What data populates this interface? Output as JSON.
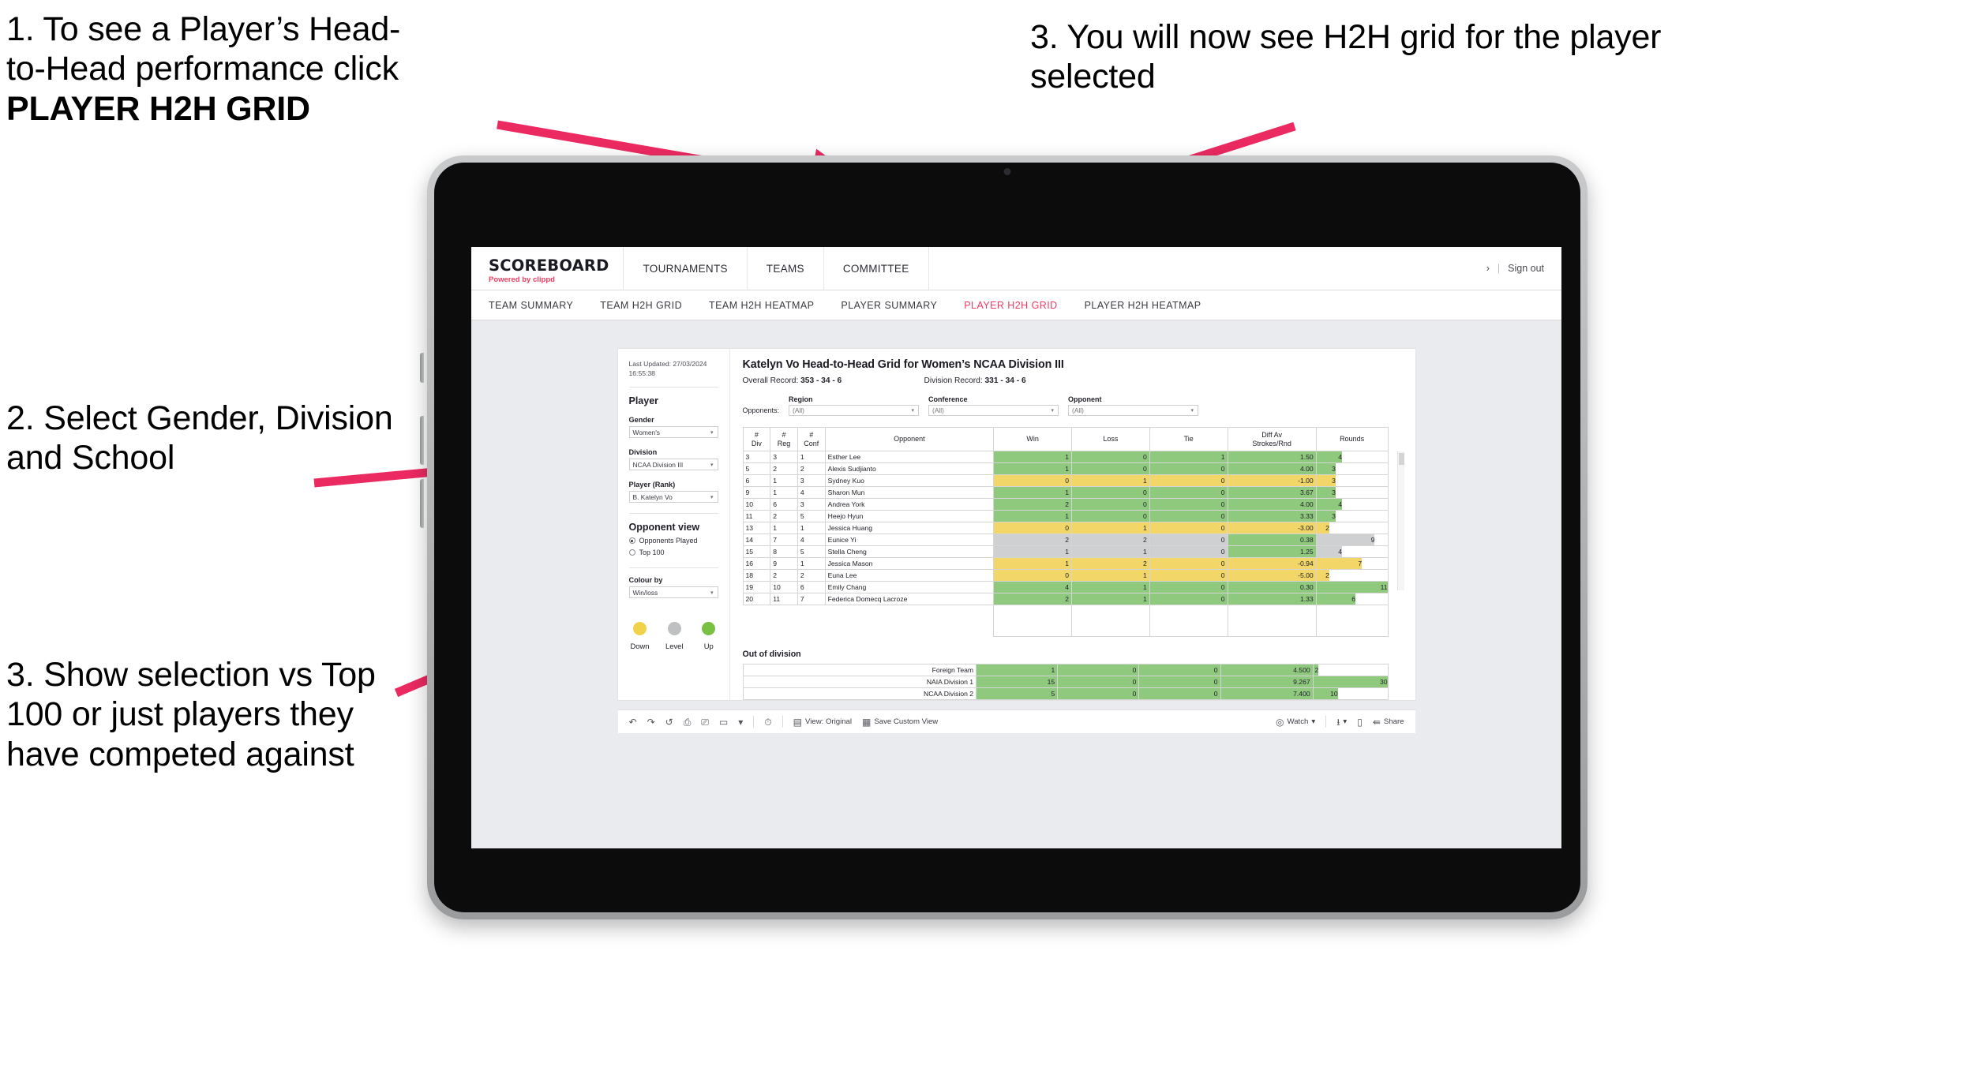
{
  "annotations": [
    {
      "id": "anno1",
      "line1": "1. To see a Player’s Head-",
      "line2": "to-Head performance click",
      "bold": "PLAYER H2H GRID"
    },
    {
      "id": "anno2",
      "text": "2. Select Gender, Division and School"
    },
    {
      "id": "anno3",
      "text": "3. Show selection vs Top 100 or just players they have competed against"
    },
    {
      "id": "anno4",
      "text": "3. You will now see H2H grid for the player selected"
    }
  ],
  "brand": {
    "logo": "SCOREBOARD",
    "powered_prefix": "Powered by ",
    "powered_name": "clippd"
  },
  "topnav": {
    "items": [
      "TOURNAMENTS",
      "TEAMS",
      "COMMITTEE"
    ],
    "chevron": "›",
    "separator": "|",
    "signout": "Sign out"
  },
  "tabs": [
    {
      "label": "TEAM SUMMARY",
      "active": false
    },
    {
      "label": "TEAM H2H GRID",
      "active": false
    },
    {
      "label": "TEAM H2H HEATMAP",
      "active": false
    },
    {
      "label": "PLAYER SUMMARY",
      "active": false
    },
    {
      "label": "PLAYER H2H GRID",
      "active": true
    },
    {
      "label": "PLAYER H2H HEATMAP",
      "active": false
    }
  ],
  "filters": {
    "last_updated": "Last Updated: 27/03/2024 16:55:38",
    "player_title": "Player",
    "gender_label": "Gender",
    "gender_value": "Women's",
    "division_label": "Division",
    "division_value": "NCAA Division III",
    "player_rank_label": "Player (Rank)",
    "player_rank_value": "B. Katelyn Vo",
    "opponent_view_title": "Opponent view",
    "opponent_view_options": [
      {
        "label": "Opponents Played",
        "selected": true
      },
      {
        "label": "Top 100",
        "selected": false
      }
    ],
    "colour_by_label": "Colour by",
    "colour_by_value": "Win/loss",
    "legend": [
      {
        "label": "Down",
        "color": "#f2d24b"
      },
      {
        "label": "Level",
        "color": "#bfc0c2"
      },
      {
        "label": "Up",
        "color": "#7ac143"
      }
    ]
  },
  "report": {
    "title": "Katelyn Vo Head-to-Head Grid for Women’s NCAA Division III",
    "overall_record_label": "Overall Record:",
    "overall_record_value": "353 - 34 - 6",
    "division_record_label": "Division Record:",
    "division_record_value": "331 - 34 - 6",
    "opponents_label": "Opponents:",
    "opponent_filters": [
      {
        "caption": "Region",
        "value": "(All)"
      },
      {
        "caption": "Conference",
        "value": "(All)"
      },
      {
        "caption": "Opponent",
        "value": "(All)"
      }
    ],
    "columns": [
      "# Div",
      "# Reg",
      "# Conf",
      "Opponent",
      "Win",
      "Loss",
      "Tie",
      "Diff Av Strokes/Rnd",
      "Rounds"
    ],
    "column_lines": [
      [
        "#",
        "Div"
      ],
      [
        "#",
        "Reg"
      ],
      [
        "#",
        "Conf"
      ],
      [
        "Opponent",
        ""
      ],
      [
        "Win",
        ""
      ],
      [
        "Loss",
        ""
      ],
      [
        "Tie",
        ""
      ],
      [
        "Diff Av",
        "Strokes/Rnd"
      ],
      [
        "Rounds",
        ""
      ]
    ],
    "rows": [
      {
        "div": "3",
        "reg": "3",
        "conf": "1",
        "opponent": "Esther Lee",
        "win": "1",
        "loss": "0",
        "tie": "1",
        "diff": "1.50",
        "rounds": "4",
        "color": "up",
        "bar_pct": 36
      },
      {
        "div": "5",
        "reg": "2",
        "conf": "2",
        "opponent": "Alexis Sudjianto",
        "win": "1",
        "loss": "0",
        "tie": "0",
        "diff": "4.00",
        "rounds": "3",
        "color": "up",
        "bar_pct": 27
      },
      {
        "div": "6",
        "reg": "1",
        "conf": "3",
        "opponent": "Sydney Kuo",
        "win": "0",
        "loss": "1",
        "tie": "0",
        "diff": "-1.00",
        "rounds": "3",
        "color": "down",
        "bar_pct": 27
      },
      {
        "div": "9",
        "reg": "1",
        "conf": "4",
        "opponent": "Sharon Mun",
        "win": "1",
        "loss": "0",
        "tie": "0",
        "diff": "3.67",
        "rounds": "3",
        "color": "up",
        "bar_pct": 27
      },
      {
        "div": "10",
        "reg": "6",
        "conf": "3",
        "opponent": "Andrea York",
        "win": "2",
        "loss": "0",
        "tie": "0",
        "diff": "4.00",
        "rounds": "4",
        "color": "up",
        "bar_pct": 36
      },
      {
        "div": "11",
        "reg": "2",
        "conf": "5",
        "opponent": "Heejo Hyun",
        "win": "1",
        "loss": "0",
        "tie": "0",
        "diff": "3.33",
        "rounds": "3",
        "color": "up",
        "bar_pct": 27
      },
      {
        "div": "13",
        "reg": "1",
        "conf": "1",
        "opponent": "Jessica Huang",
        "win": "0",
        "loss": "1",
        "tie": "0",
        "diff": "-3.00",
        "rounds": "2",
        "color": "down",
        "bar_pct": 18
      },
      {
        "div": "14",
        "reg": "7",
        "conf": "4",
        "opponent": "Eunice Yi",
        "win": "2",
        "loss": "2",
        "tie": "0",
        "diff": "0.38",
        "rounds": "9",
        "color": "level",
        "bar_pct": 82,
        "diff_color": "up"
      },
      {
        "div": "15",
        "reg": "8",
        "conf": "5",
        "opponent": "Stella Cheng",
        "win": "1",
        "loss": "1",
        "tie": "0",
        "diff": "1.25",
        "rounds": "4",
        "color": "level",
        "bar_pct": 36,
        "diff_color": "up"
      },
      {
        "div": "16",
        "reg": "9",
        "conf": "1",
        "opponent": "Jessica Mason",
        "win": "1",
        "loss": "2",
        "tie": "0",
        "diff": "-0.94",
        "rounds": "7",
        "color": "down",
        "bar_pct": 64
      },
      {
        "div": "18",
        "reg": "2",
        "conf": "2",
        "opponent": "Euna Lee",
        "win": "0",
        "loss": "1",
        "tie": "0",
        "diff": "-5.00",
        "rounds": "2",
        "color": "down",
        "bar_pct": 18
      },
      {
        "div": "19",
        "reg": "10",
        "conf": "6",
        "opponent": "Emily Chang",
        "win": "4",
        "loss": "1",
        "tie": "0",
        "diff": "0.30",
        "rounds": "11",
        "color": "up",
        "bar_pct": 100
      },
      {
        "div": "20",
        "reg": "11",
        "conf": "7",
        "opponent": "Federica Domecq Lacroze",
        "win": "2",
        "loss": "1",
        "tie": "0",
        "diff": "1.33",
        "rounds": "6",
        "color": "up",
        "bar_pct": 55
      }
    ],
    "out_of_division_title": "Out of division",
    "out_of_division_rows": [
      {
        "name": "Foreign Team",
        "win": "1",
        "loss": "0",
        "tie": "0",
        "diff": "4.500",
        "rounds": "2",
        "bar_pct": 7
      },
      {
        "name": "NAIA Division 1",
        "win": "15",
        "loss": "0",
        "tie": "0",
        "diff": "9.267",
        "rounds": "30",
        "bar_pct": 100
      },
      {
        "name": "NCAA Division 2",
        "win": "5",
        "loss": "0",
        "tie": "0",
        "diff": "7.400",
        "rounds": "10",
        "bar_pct": 33
      }
    ]
  },
  "toolbar": {
    "undo": "↶",
    "redo": "↷",
    "revert": "↺",
    "refresh": "⭮",
    "pause": "⏸",
    "dropdown_caret": "▾",
    "view_original": "View: Original",
    "save_custom_view": "Save Custom View",
    "watch": "Watch",
    "share": "Share"
  },
  "colors": {
    "accent": "#ee3a64",
    "up": "#8fc97e",
    "down": "#f2d668",
    "level": "#cfd0d2",
    "arrow": "#ec2a62"
  }
}
